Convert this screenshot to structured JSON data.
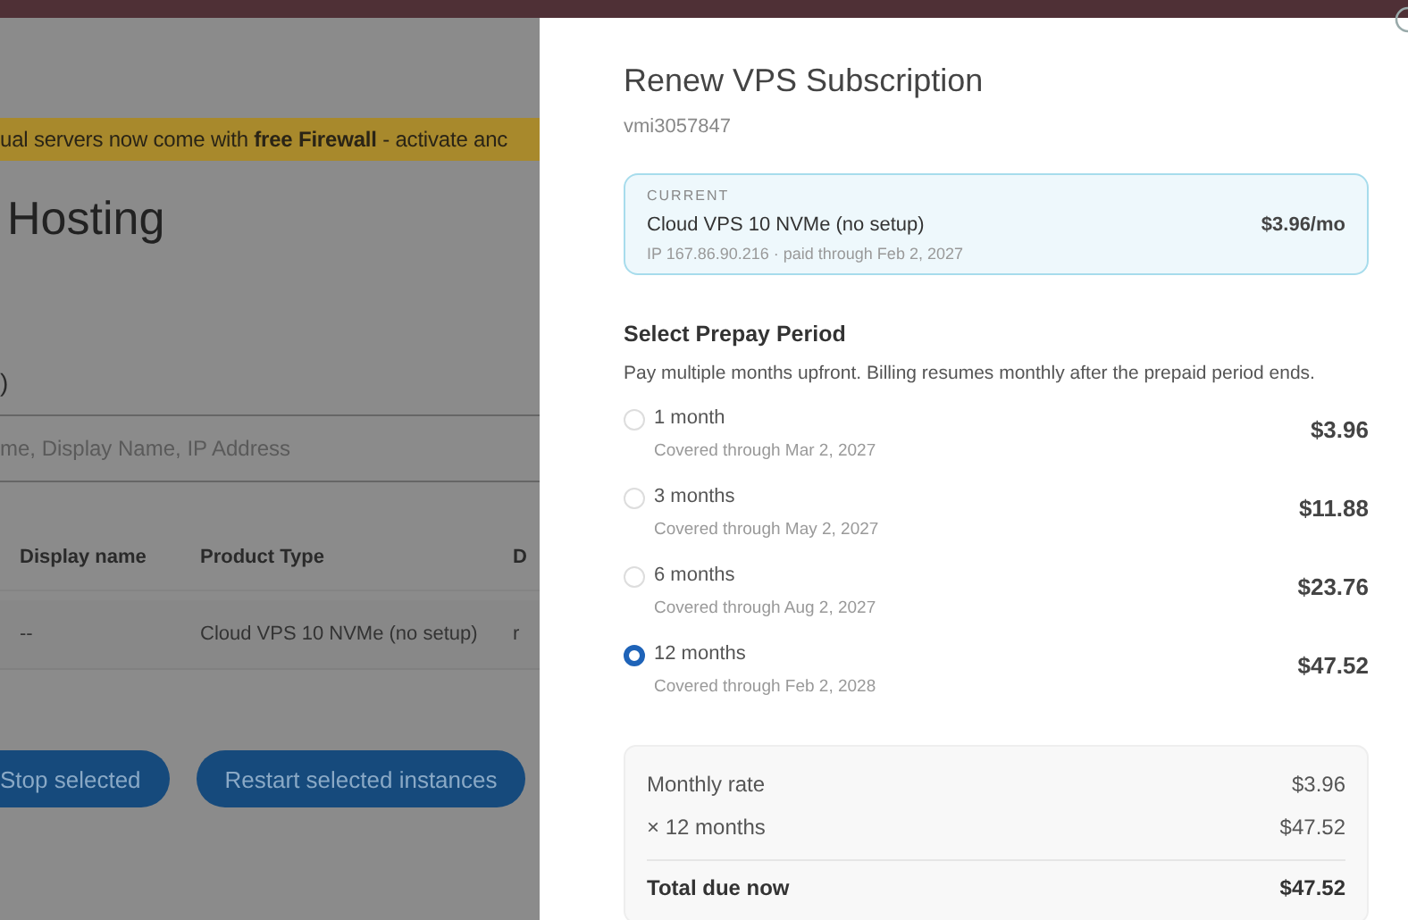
{
  "background_page": {
    "banner": {
      "before": "ual servers now come with ",
      "bold": "free Firewall",
      "after": " - activate anc"
    },
    "title": "Hosting",
    "count_suffix": ")",
    "search": {
      "placeholder": "me, Display Name, IP Address"
    },
    "table": {
      "columns": [
        "Display name",
        "Product Type",
        "D"
      ],
      "rows": [
        {
          "cells": [
            "--",
            "Cloud VPS 10 NVMe (no setup)",
            "r"
          ]
        }
      ]
    },
    "buttons": [
      "Stop selected",
      "Restart selected instances"
    ]
  },
  "drawer": {
    "title": "Renew VPS Subscription",
    "subtitle": "vmi3057847",
    "current": {
      "label": "CURRENT",
      "product": "Cloud VPS 10 NVMe (no setup)",
      "price": "$3.96/mo",
      "details": "IP 167.86.90.216 · paid through Feb 2, 2027"
    },
    "section_title": "Select Prepay Period",
    "section_description": "Pay multiple months upfront. Billing resumes monthly after the prepaid period ends.",
    "options": [
      {
        "label": "1 month",
        "coverage": "Covered through Mar 2, 2027",
        "price": "$3.96",
        "selected": false
      },
      {
        "label": "3 months",
        "coverage": "Covered through May 2, 2027",
        "price": "$11.88",
        "selected": false
      },
      {
        "label": "6 months",
        "coverage": "Covered through Aug 2, 2027",
        "price": "$23.76",
        "selected": false
      },
      {
        "label": "12 months",
        "coverage": "Covered through Feb 2, 2028",
        "price": "$47.52",
        "selected": true
      }
    ],
    "summary": {
      "lines": [
        {
          "label": "Monthly rate",
          "value": "$3.96"
        },
        {
          "label": "× 12 months",
          "value": "$47.52"
        }
      ],
      "total": {
        "label": "Total due now",
        "value": "$47.52"
      }
    }
  }
}
